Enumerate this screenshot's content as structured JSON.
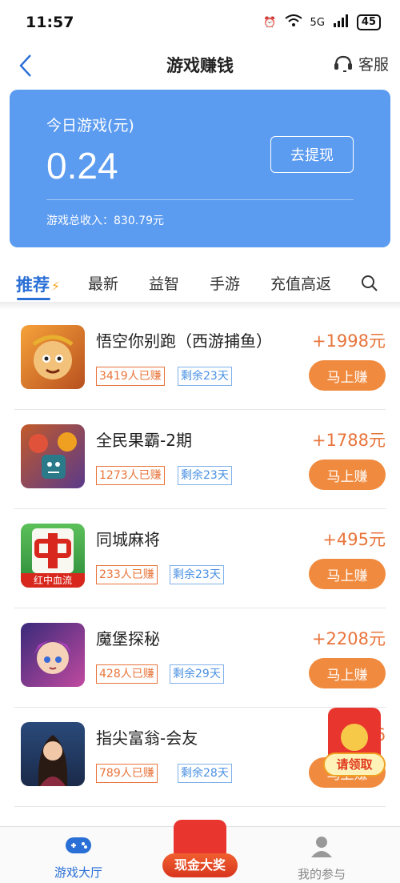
{
  "status_bar": {
    "time": "11:57",
    "network": "5G",
    "battery": "45"
  },
  "nav": {
    "title": "游戏赚钱",
    "service_label": "客服"
  },
  "earnings": {
    "label": "今日游戏(元)",
    "amount": "0.24",
    "withdraw_label": "去提现",
    "total_label": "游戏总收入：830.79元"
  },
  "tabs": [
    {
      "label": "推荐",
      "active": true
    },
    {
      "label": "最新"
    },
    {
      "label": "益智"
    },
    {
      "label": "手游"
    },
    {
      "label": "充值高返"
    }
  ],
  "games": [
    {
      "name": "悟空你别跑（西游捕鱼）",
      "reward": "+1998元",
      "earned": "3419人已赚",
      "remaining": "剩余23天",
      "button": "马上赚"
    },
    {
      "name": "全民果霸-2期",
      "reward": "+1788元",
      "earned": "1273人已赚",
      "remaining": "剩余23天",
      "button": "马上赚"
    },
    {
      "name": "同城麻将",
      "reward": "+495元",
      "earned": "233人已赚",
      "remaining": "剩余23天",
      "button": "马上赚",
      "icon_text": "红中血流"
    },
    {
      "name": "魔堡探秘",
      "reward": "+2208元",
      "earned": "428人已赚",
      "remaining": "剩余29天",
      "button": "马上赚"
    },
    {
      "name": "指尖富翁-会友",
      "reward": "+6",
      "earned": "789人已赚",
      "remaining": "剩余28天",
      "button": "马上赚"
    }
  ],
  "floating": {
    "claim_label": "请领取"
  },
  "bottom_tabs": {
    "lobby": "游戏大厅",
    "cash": "现金大奖",
    "mine": "我的参与"
  },
  "colors": {
    "accent": "#2a6fd6",
    "card": "#5b9bf0",
    "reward": "#e8743b",
    "button": "#f08a3e"
  }
}
